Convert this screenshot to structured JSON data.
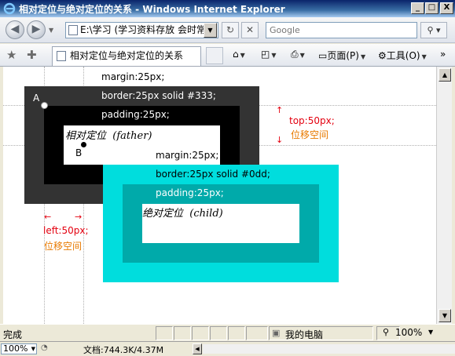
{
  "window": {
    "title": "相对定位与绝对定位的关系 - Windows Internet Explorer",
    "minimize": "_",
    "maximize": "□",
    "close": "X"
  },
  "address_bar": {
    "url": "E:\\学习 (学习资料存放 会时常",
    "search_placeholder": "Google"
  },
  "tab": {
    "title": "相对定位与绝对定位的关系"
  },
  "commands": {
    "page": "页面(P)",
    "tools": "工具(O)"
  },
  "diagram": {
    "father": {
      "margin": "margin:25px;",
      "border": "border:25px solid #333;",
      "padding": "padding:25px;",
      "label_cn": "相对定位",
      "label_en": "(father)",
      "corner": "A"
    },
    "child": {
      "margin": "margin:25px;",
      "border": "border:25px solid #0dd;",
      "padding": "padding:25px;",
      "label_cn": "绝对定位",
      "label_en": "(child)",
      "corner": "B"
    },
    "top_note": {
      "value": "top:50px;",
      "desc": "位移空间"
    },
    "left_note": {
      "value": "left:50px;",
      "desc": "位移空间"
    },
    "colors": {
      "father_border": "#333333",
      "child_border": "#00dddd",
      "child_inner": "#00aaaa",
      "note_red": "#e4000f",
      "note_orange": "#e87a00"
    }
  },
  "status": {
    "text": "完成",
    "zone": "我的电脑",
    "zoom": "100%"
  },
  "bottom": {
    "zoom": "100%",
    "doc_size": "文档:744.3K/4.37M"
  }
}
